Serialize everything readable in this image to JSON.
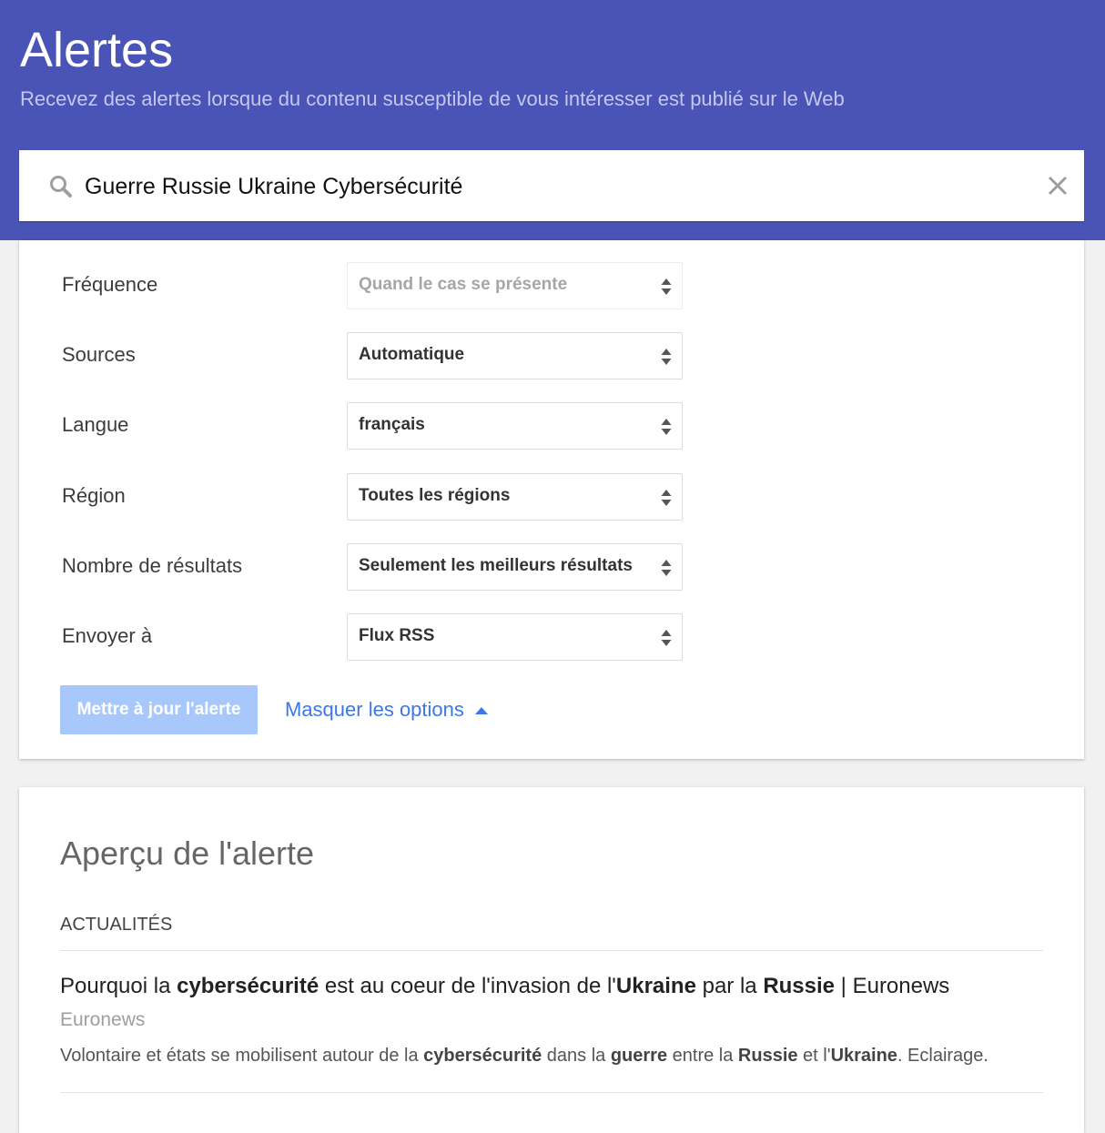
{
  "header": {
    "title": "Alertes",
    "subtitle": "Recevez des alertes lorsque du contenu susceptible de vous intéresser est publié sur le Web",
    "background_color": "#4a53b6"
  },
  "search": {
    "query": "Guerre Russie Ukraine Cybersécurité",
    "search_icon": "search-icon",
    "clear_icon": "close-icon"
  },
  "options": [
    {
      "label": "Fréquence",
      "value": "Quand le cas se présente",
      "disabled": true
    },
    {
      "label": "Sources",
      "value": "Automatique"
    },
    {
      "label": "Langue",
      "value": "français"
    },
    {
      "label": "Région",
      "value": "Toutes les régions"
    },
    {
      "label": "Nombre de résultats",
      "value": "Seulement les meilleurs résultats"
    },
    {
      "label": "Envoyer à",
      "value": "Flux RSS"
    }
  ],
  "actions": {
    "update_button": "Mettre à jour l'alerte",
    "toggle_options": "Masquer les options",
    "accent_color": "#3b78e7"
  },
  "preview": {
    "title": "Aperçu de l'alerte",
    "section": "ACTUALITÉS",
    "results": [
      {
        "title_parts": [
          {
            "text": "Pourquoi la ",
            "bold": false
          },
          {
            "text": "cybersécurité",
            "bold": true
          },
          {
            "text": " est au coeur de l'invasion de l'",
            "bold": false
          },
          {
            "text": "Ukraine",
            "bold": true
          },
          {
            "text": " par la ",
            "bold": false
          },
          {
            "text": "Russie",
            "bold": true
          },
          {
            "text": " | Euronews",
            "bold": false
          }
        ],
        "source": "Euronews",
        "snippet_parts": [
          {
            "text": "Volontaire et états se mobilisent autour de la ",
            "bold": false
          },
          {
            "text": "cybersécurité",
            "bold": true
          },
          {
            "text": " dans la ",
            "bold": false
          },
          {
            "text": "guerre",
            "bold": true
          },
          {
            "text": " entre la ",
            "bold": false
          },
          {
            "text": "Russie",
            "bold": true
          },
          {
            "text": " et l'",
            "bold": false
          },
          {
            "text": "Ukraine",
            "bold": true
          },
          {
            "text": ". Eclairage.",
            "bold": false
          }
        ]
      }
    ]
  }
}
